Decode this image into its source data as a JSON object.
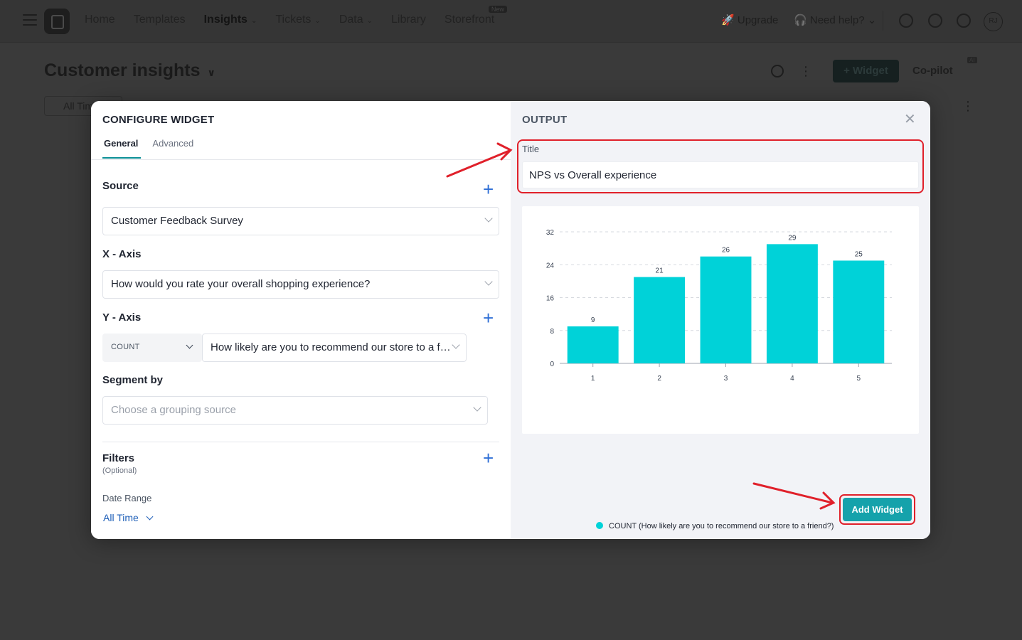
{
  "app": {
    "nav": [
      {
        "label": "Home",
        "chevron": false
      },
      {
        "label": "Templates",
        "chevron": false
      },
      {
        "label": "Insights",
        "chevron": true,
        "active": true
      },
      {
        "label": "Tickets",
        "chevron": true
      },
      {
        "label": "Data",
        "chevron": true
      },
      {
        "label": "Library",
        "chevron": false
      },
      {
        "label": "Storefront",
        "chevron": false,
        "badge": "New"
      }
    ],
    "upgrade_label": "Upgrade",
    "help_label": "Need help?",
    "avatar_initials": "RJ",
    "page_title": "Customer insights",
    "widget_button": "+ Widget",
    "copilot_label": "Co-pilot",
    "ai_badge": "AI",
    "date_chip": "All Time"
  },
  "modal": {
    "configure_title": "CONFIGURE WIDGET",
    "tabs": {
      "general": "General",
      "advanced": "Advanced"
    },
    "source": {
      "label": "Source",
      "value": "Customer Feedback Survey"
    },
    "x_axis": {
      "label": "X - Axis",
      "value": "How would you rate your overall shopping experience?"
    },
    "y_axis": {
      "label": "Y - Axis",
      "aggregate": "COUNT",
      "value": "How likely are you to recommend our store to a f…"
    },
    "segment": {
      "label": "Segment by",
      "placeholder": "Choose a grouping source"
    },
    "filters": {
      "label": "Filters",
      "optional": "(Optional)",
      "date_range_label": "Date Range",
      "date_range_value": "All Time"
    },
    "output_title": "OUTPUT",
    "title_field": {
      "label": "Title",
      "value": "NPS vs Overall experience"
    },
    "add_button": "Add Widget"
  },
  "chart_data": {
    "type": "bar",
    "categories": [
      "1",
      "2",
      "3",
      "4",
      "5"
    ],
    "series": [
      {
        "name": "COUNT (How likely are you to recommend our store to a friend?)",
        "values": [
          9,
          21,
          26,
          29,
          25
        ]
      }
    ],
    "yticks": [
      0,
      8,
      16,
      24,
      32
    ],
    "ylim": [
      0,
      32
    ],
    "grid": true,
    "legend": "bottom",
    "bar_color": "#00d2d8"
  }
}
